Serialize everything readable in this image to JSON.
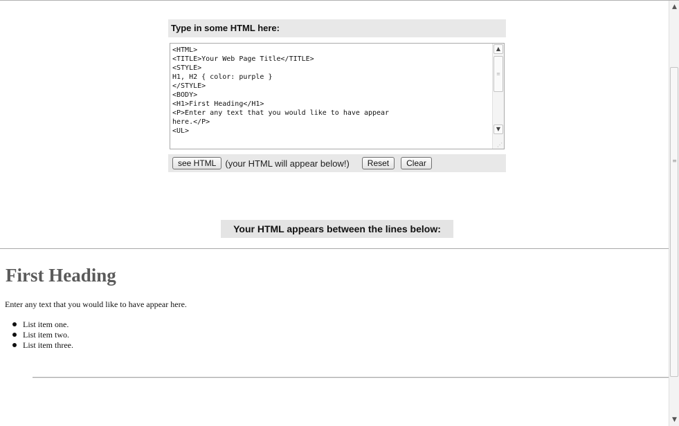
{
  "editor": {
    "title": "Type in some HTML here:",
    "code": "<HTML>\n<TITLE>Your Web Page Title</TITLE>\n<STYLE>\nH1, H2 { color: purple }\n</STYLE>\n<BODY>\n<H1>First Heading</H1>\n<P>Enter any text that you would like to have appear\nhere.</P>\n<UL>",
    "see_html_label": "see HTML",
    "hint": "(your HTML will appear below!)",
    "reset_label": "Reset",
    "clear_label": "Clear"
  },
  "output_header": "Your HTML appears between the lines below:",
  "output": {
    "heading": "First Heading",
    "paragraph": "Enter any text that you would like to have appear here.",
    "list_items": [
      "List item one.",
      "List item two.",
      "List item three."
    ]
  },
  "icons": {
    "scroll_up": "up-arrow-icon",
    "scroll_down": "down-arrow-icon",
    "resize": "resize-grip-icon"
  },
  "colors": {
    "panel_bg": "#e8e8e8",
    "heading_color": "#5a5a5a"
  }
}
